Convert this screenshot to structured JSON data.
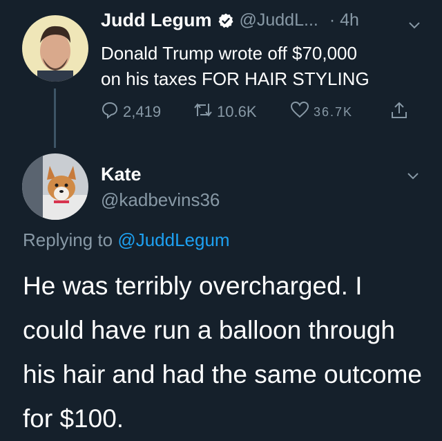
{
  "quoted_tweet": {
    "author_name": "Judd Legum",
    "author_handle": "@JuddL...",
    "time": "· 4h",
    "text_line1": "Donald Trump wrote off $70,000",
    "text_line2": "on his taxes FOR HAIR STYLING",
    "reply_count": "2,419",
    "retweet_count": "10.6K",
    "like_count": "36.7K",
    "verified": true
  },
  "reply_tweet": {
    "author_name": "Kate",
    "author_handle": "@kadbevins36",
    "replying_to_prefix": "Replying to",
    "replying_to_handle": "@JuddLegum",
    "text": "He was terribly overcharged.  I could have run a balloon through his hair and had the same outcome for $100."
  },
  "colors": {
    "background": "#15202b",
    "text": "#ffffff",
    "muted": "#8899a6",
    "link": "#1da1f2",
    "thread_line": "#3d5466"
  },
  "icons": [
    "reply-icon",
    "retweet-icon",
    "like-icon",
    "share-icon",
    "chevron-down-icon",
    "verified-badge-icon"
  ]
}
